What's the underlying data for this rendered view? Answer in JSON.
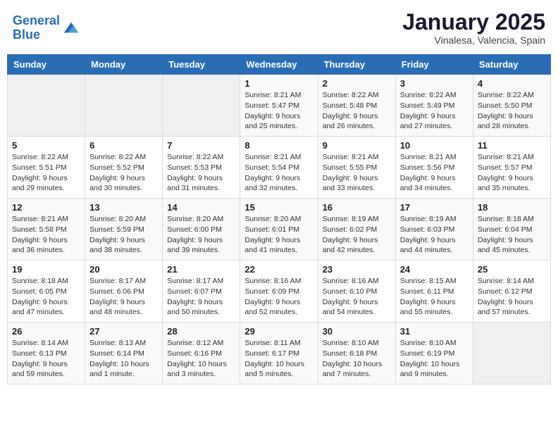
{
  "header": {
    "logo_line1": "General",
    "logo_line2": "Blue",
    "month": "January 2025",
    "location": "Vinalesa, Valencia, Spain"
  },
  "weekdays": [
    "Sunday",
    "Monday",
    "Tuesday",
    "Wednesday",
    "Thursday",
    "Friday",
    "Saturday"
  ],
  "weeks": [
    [
      {
        "day": "",
        "sunrise": "",
        "sunset": "",
        "daylight": ""
      },
      {
        "day": "",
        "sunrise": "",
        "sunset": "",
        "daylight": ""
      },
      {
        "day": "",
        "sunrise": "",
        "sunset": "",
        "daylight": ""
      },
      {
        "day": "1",
        "sunrise": "Sunrise: 8:21 AM",
        "sunset": "Sunset: 5:47 PM",
        "daylight": "Daylight: 9 hours and 25 minutes."
      },
      {
        "day": "2",
        "sunrise": "Sunrise: 8:22 AM",
        "sunset": "Sunset: 5:48 PM",
        "daylight": "Daylight: 9 hours and 26 minutes."
      },
      {
        "day": "3",
        "sunrise": "Sunrise: 8:22 AM",
        "sunset": "Sunset: 5:49 PM",
        "daylight": "Daylight: 9 hours and 27 minutes."
      },
      {
        "day": "4",
        "sunrise": "Sunrise: 8:22 AM",
        "sunset": "Sunset: 5:50 PM",
        "daylight": "Daylight: 9 hours and 28 minutes."
      }
    ],
    [
      {
        "day": "5",
        "sunrise": "Sunrise: 8:22 AM",
        "sunset": "Sunset: 5:51 PM",
        "daylight": "Daylight: 9 hours and 29 minutes."
      },
      {
        "day": "6",
        "sunrise": "Sunrise: 8:22 AM",
        "sunset": "Sunset: 5:52 PM",
        "daylight": "Daylight: 9 hours and 30 minutes."
      },
      {
        "day": "7",
        "sunrise": "Sunrise: 8:22 AM",
        "sunset": "Sunset: 5:53 PM",
        "daylight": "Daylight: 9 hours and 31 minutes."
      },
      {
        "day": "8",
        "sunrise": "Sunrise: 8:21 AM",
        "sunset": "Sunset: 5:54 PM",
        "daylight": "Daylight: 9 hours and 32 minutes."
      },
      {
        "day": "9",
        "sunrise": "Sunrise: 8:21 AM",
        "sunset": "Sunset: 5:55 PM",
        "daylight": "Daylight: 9 hours and 33 minutes."
      },
      {
        "day": "10",
        "sunrise": "Sunrise: 8:21 AM",
        "sunset": "Sunset: 5:56 PM",
        "daylight": "Daylight: 9 hours and 34 minutes."
      },
      {
        "day": "11",
        "sunrise": "Sunrise: 8:21 AM",
        "sunset": "Sunset: 5:57 PM",
        "daylight": "Daylight: 9 hours and 35 minutes."
      }
    ],
    [
      {
        "day": "12",
        "sunrise": "Sunrise: 8:21 AM",
        "sunset": "Sunset: 5:58 PM",
        "daylight": "Daylight: 9 hours and 36 minutes."
      },
      {
        "day": "13",
        "sunrise": "Sunrise: 8:20 AM",
        "sunset": "Sunset: 5:59 PM",
        "daylight": "Daylight: 9 hours and 38 minutes."
      },
      {
        "day": "14",
        "sunrise": "Sunrise: 8:20 AM",
        "sunset": "Sunset: 6:00 PM",
        "daylight": "Daylight: 9 hours and 39 minutes."
      },
      {
        "day": "15",
        "sunrise": "Sunrise: 8:20 AM",
        "sunset": "Sunset: 6:01 PM",
        "daylight": "Daylight: 9 hours and 41 minutes."
      },
      {
        "day": "16",
        "sunrise": "Sunrise: 8:19 AM",
        "sunset": "Sunset: 6:02 PM",
        "daylight": "Daylight: 9 hours and 42 minutes."
      },
      {
        "day": "17",
        "sunrise": "Sunrise: 8:19 AM",
        "sunset": "Sunset: 6:03 PM",
        "daylight": "Daylight: 9 hours and 44 minutes."
      },
      {
        "day": "18",
        "sunrise": "Sunrise: 8:18 AM",
        "sunset": "Sunset: 6:04 PM",
        "daylight": "Daylight: 9 hours and 45 minutes."
      }
    ],
    [
      {
        "day": "19",
        "sunrise": "Sunrise: 8:18 AM",
        "sunset": "Sunset: 6:05 PM",
        "daylight": "Daylight: 9 hours and 47 minutes."
      },
      {
        "day": "20",
        "sunrise": "Sunrise: 8:17 AM",
        "sunset": "Sunset: 6:06 PM",
        "daylight": "Daylight: 9 hours and 48 minutes."
      },
      {
        "day": "21",
        "sunrise": "Sunrise: 8:17 AM",
        "sunset": "Sunset: 6:07 PM",
        "daylight": "Daylight: 9 hours and 50 minutes."
      },
      {
        "day": "22",
        "sunrise": "Sunrise: 8:16 AM",
        "sunset": "Sunset: 6:09 PM",
        "daylight": "Daylight: 9 hours and 52 minutes."
      },
      {
        "day": "23",
        "sunrise": "Sunrise: 8:16 AM",
        "sunset": "Sunset: 6:10 PM",
        "daylight": "Daylight: 9 hours and 54 minutes."
      },
      {
        "day": "24",
        "sunrise": "Sunrise: 8:15 AM",
        "sunset": "Sunset: 6:11 PM",
        "daylight": "Daylight: 9 hours and 55 minutes."
      },
      {
        "day": "25",
        "sunrise": "Sunrise: 8:14 AM",
        "sunset": "Sunset: 6:12 PM",
        "daylight": "Daylight: 9 hours and 57 minutes."
      }
    ],
    [
      {
        "day": "26",
        "sunrise": "Sunrise: 8:14 AM",
        "sunset": "Sunset: 6:13 PM",
        "daylight": "Daylight: 9 hours and 59 minutes."
      },
      {
        "day": "27",
        "sunrise": "Sunrise: 8:13 AM",
        "sunset": "Sunset: 6:14 PM",
        "daylight": "Daylight: 10 hours and 1 minute."
      },
      {
        "day": "28",
        "sunrise": "Sunrise: 8:12 AM",
        "sunset": "Sunset: 6:16 PM",
        "daylight": "Daylight: 10 hours and 3 minutes."
      },
      {
        "day": "29",
        "sunrise": "Sunrise: 8:11 AM",
        "sunset": "Sunset: 6:17 PM",
        "daylight": "Daylight: 10 hours and 5 minutes."
      },
      {
        "day": "30",
        "sunrise": "Sunrise: 8:10 AM",
        "sunset": "Sunset: 6:18 PM",
        "daylight": "Daylight: 10 hours and 7 minutes."
      },
      {
        "day": "31",
        "sunrise": "Sunrise: 8:10 AM",
        "sunset": "Sunset: 6:19 PM",
        "daylight": "Daylight: 10 hours and 9 minutes."
      },
      {
        "day": "",
        "sunrise": "",
        "sunset": "",
        "daylight": ""
      }
    ]
  ]
}
